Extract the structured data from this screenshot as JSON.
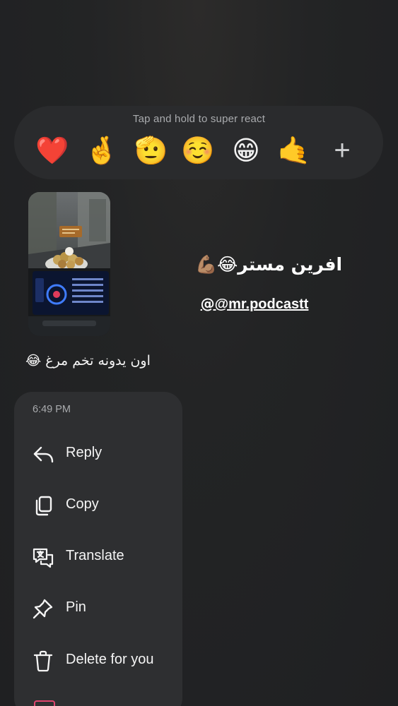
{
  "reaction_bar": {
    "hint": "Tap and hold to super react",
    "emojis": [
      {
        "name": "red-heart",
        "glyph": "❤️"
      },
      {
        "name": "crossed-fingers",
        "glyph": "🤞"
      },
      {
        "name": "saluting-face",
        "glyph": "🫡"
      },
      {
        "name": "smiling-face",
        "glyph": "☺️"
      },
      {
        "name": "beaming-face",
        "glyph": "😁"
      },
      {
        "name": "call-me-hand",
        "glyph": "🤙"
      }
    ],
    "more_label": "+"
  },
  "story": {
    "caption": "افرین مستر😂💪🏽",
    "handle": "@mr.podcastt"
  },
  "message": {
    "text": "اون یدونه تخم مرغ 😂"
  },
  "context_menu": {
    "timestamp": "6:49 PM",
    "items": [
      {
        "label": "Reply",
        "icon": "reply-icon"
      },
      {
        "label": "Copy",
        "icon": "copy-icon"
      },
      {
        "label": "Translate",
        "icon": "translate-icon"
      },
      {
        "label": "Pin",
        "icon": "pin-icon"
      },
      {
        "label": "Delete for you",
        "icon": "trash-icon"
      }
    ]
  },
  "colors": {
    "background": "#222325",
    "panel": "#2e2f31",
    "muted_text": "#a9abae",
    "destructive_peek": "#e0456f"
  }
}
